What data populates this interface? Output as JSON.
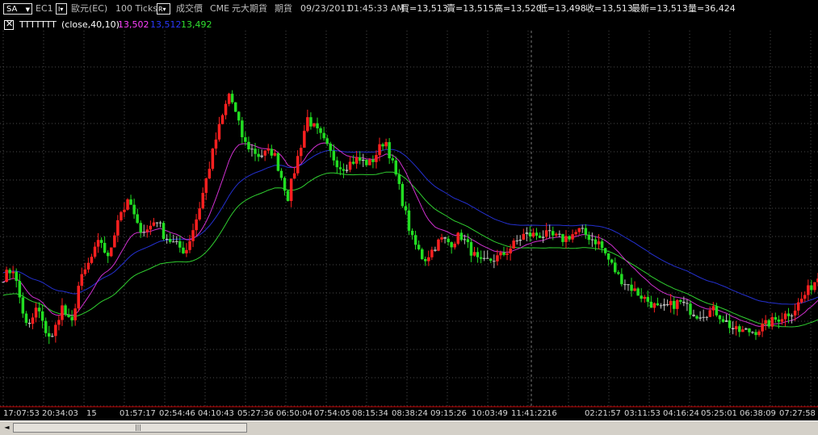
{
  "toolbar": {
    "symbol_btn": "SA",
    "contract": "EC1",
    "product": "歐元(EC)",
    "interval": "100 Ticks",
    "price_field": "成交價",
    "exchange": "CME",
    "broker_label": "元大期貨",
    "market_type": "期貨",
    "date": "09/23/2011",
    "time": "01:45:33 AM",
    "bid": "買=13,513",
    "ask": "賣=13,515",
    "high": "高=13,520",
    "low": "低=13,498",
    "close": "收=13,513",
    "last": "最新=13,513",
    "volume": "量=36,424"
  },
  "indicator": {
    "name": "TTTTTTT",
    "params": "(close,40,10)",
    "val_mid": "13,502",
    "val_upper": "13,512",
    "val_lower": "13,492"
  },
  "colors": {
    "up": "#ff2020",
    "down": "#22dd22",
    "neutral": "#c0c0c0",
    "upper_band": "#2430d0",
    "mid_band": "#d030d0",
    "lower_band": "#30d030",
    "grid": "#4a4a4a",
    "axis_line": "#cc0000"
  },
  "xaxis": {
    "labels": [
      "17:07:53",
      "20:34:03",
      "15",
      "01:57:17",
      "02:54:46",
      "04:10:43",
      "05:27:36",
      "06:50:04",
      "07:54:05",
      "08:15:34",
      "08:38:24",
      "09:15:26",
      "10:03:49",
      "11:41:22",
      "16",
      "02:21:57",
      "03:11:53",
      "04:16:24",
      "05:25:01",
      "06:38:09",
      "07:27:58"
    ]
  },
  "scrollbar": {
    "left_arrow": "◄",
    "thumb_grip": "|||"
  },
  "chart_data": {
    "type": "candlestick",
    "title": "",
    "xlabel": "",
    "ylabel": "",
    "bars": 250,
    "path_keypoints": [
      [
        0,
        13512
      ],
      [
        8,
        13514
      ],
      [
        15,
        13505
      ],
      [
        20,
        13499
      ],
      [
        28,
        13505
      ],
      [
        33,
        13500
      ],
      [
        40,
        13497
      ],
      [
        48,
        13505
      ],
      [
        56,
        13500
      ],
      [
        62,
        13510
      ],
      [
        70,
        13515
      ],
      [
        80,
        13521
      ],
      [
        86,
        13516
      ],
      [
        95,
        13527
      ],
      [
        104,
        13530
      ],
      [
        110,
        13524
      ],
      [
        118,
        13523
      ],
      [
        126,
        13526
      ],
      [
        132,
        13522
      ],
      [
        140,
        13520
      ],
      [
        150,
        13518
      ],
      [
        160,
        13527
      ],
      [
        175,
        13545
      ],
      [
        186,
        13556
      ],
      [
        198,
        13544
      ],
      [
        210,
        13541
      ],
      [
        222,
        13542
      ],
      [
        234,
        13531
      ],
      [
        246,
        13545
      ],
      [
        250,
        13550
      ],
      [
        262,
        13545
      ],
      [
        270,
        13541
      ],
      [
        278,
        13538
      ],
      [
        290,
        13540
      ],
      [
        302,
        13539
      ],
      [
        314,
        13545
      ],
      [
        324,
        13535
      ],
      [
        336,
        13521
      ],
      [
        346,
        13516
      ],
      [
        360,
        13521
      ],
      [
        368,
        13520
      ],
      [
        376,
        13522
      ],
      [
        392,
        13515
      ],
      [
        410,
        13517
      ],
      [
        428,
        13522
      ],
      [
        446,
        13522
      ],
      [
        460,
        13521
      ],
      [
        474,
        13523
      ],
      [
        490,
        13520
      ],
      [
        506,
        13512
      ],
      [
        522,
        13508
      ],
      [
        540,
        13504
      ],
      [
        556,
        13506
      ],
      [
        570,
        13503
      ],
      [
        585,
        13504
      ],
      [
        602,
        13499
      ],
      [
        618,
        13499
      ],
      [
        630,
        13501
      ],
      [
        650,
        13504
      ],
      [
        670,
        13512
      ]
    ],
    "bands": {
      "upper_period": 40,
      "lower_period": 10
    }
  }
}
